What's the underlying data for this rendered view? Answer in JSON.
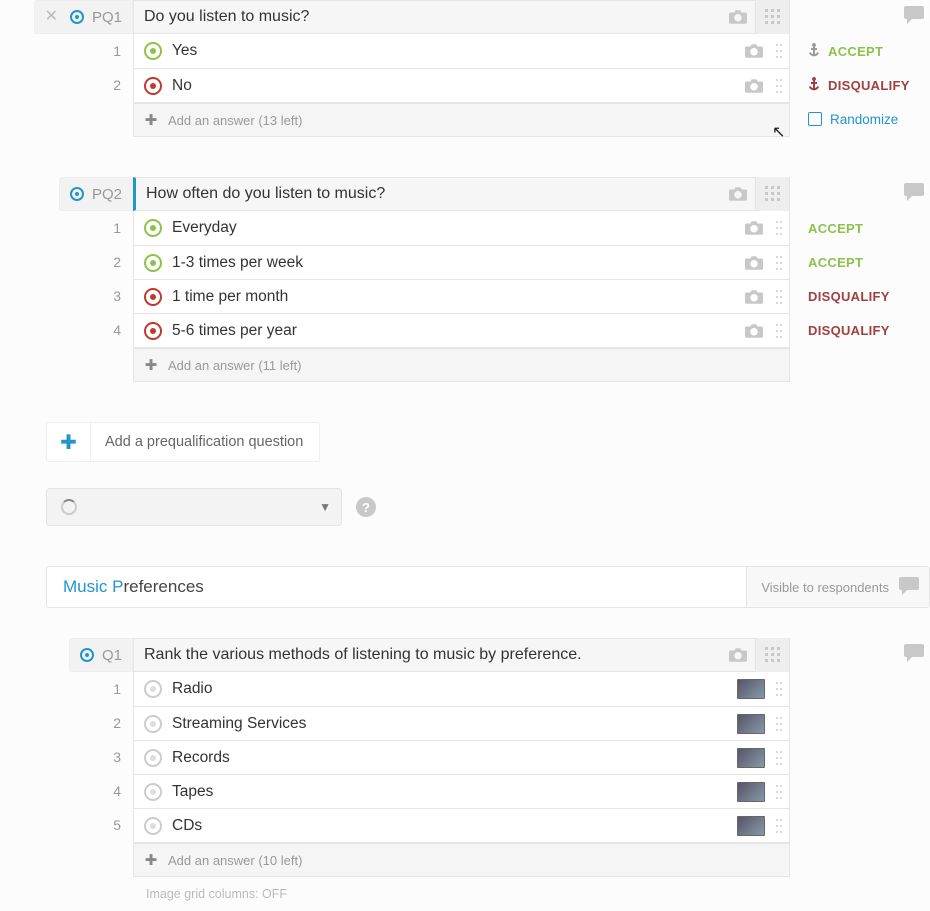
{
  "pq1": {
    "id": "PQ1",
    "title": "Do you listen to music?",
    "answers": [
      {
        "n": "1",
        "label": "Yes",
        "status": "accept"
      },
      {
        "n": "2",
        "label": "No",
        "status": "disq"
      }
    ],
    "add_answer": "Add an answer (13 left)",
    "side": {
      "accept": "ACCEPT",
      "disqualify": "DISQUALIFY",
      "randomize": "Randomize"
    }
  },
  "pq2": {
    "id": "PQ2",
    "title": "How often do you listen to music?",
    "answers": [
      {
        "n": "1",
        "label": "Everyday",
        "status": "accept"
      },
      {
        "n": "2",
        "label": "1-3 times per week",
        "status": "accept"
      },
      {
        "n": "3",
        "label": "1 time per month",
        "status": "disq"
      },
      {
        "n": "4",
        "label": "5-6 times per year",
        "status": "disq"
      }
    ],
    "add_answer": "Add an answer (11 left)",
    "side": {
      "a1": "ACCEPT",
      "a2": "ACCEPT",
      "a3": "DISQUALIFY",
      "a4": "DISQUALIFY"
    }
  },
  "add_prequal": "Add a prequalification question",
  "section": {
    "title": "Music Preferences",
    "first_letter_count": 7,
    "visibility": "Visible to respondents"
  },
  "q1": {
    "id": "Q1",
    "title": "Rank the various methods of listening to music by preference.",
    "answers": [
      {
        "n": "1",
        "label": "Radio"
      },
      {
        "n": "2",
        "label": "Streaming Services"
      },
      {
        "n": "3",
        "label": "Records"
      },
      {
        "n": "4",
        "label": "Tapes"
      },
      {
        "n": "5",
        "label": "CDs"
      }
    ],
    "add_answer": "Add an answer (10 left)",
    "footer": "Image grid columns: OFF"
  }
}
